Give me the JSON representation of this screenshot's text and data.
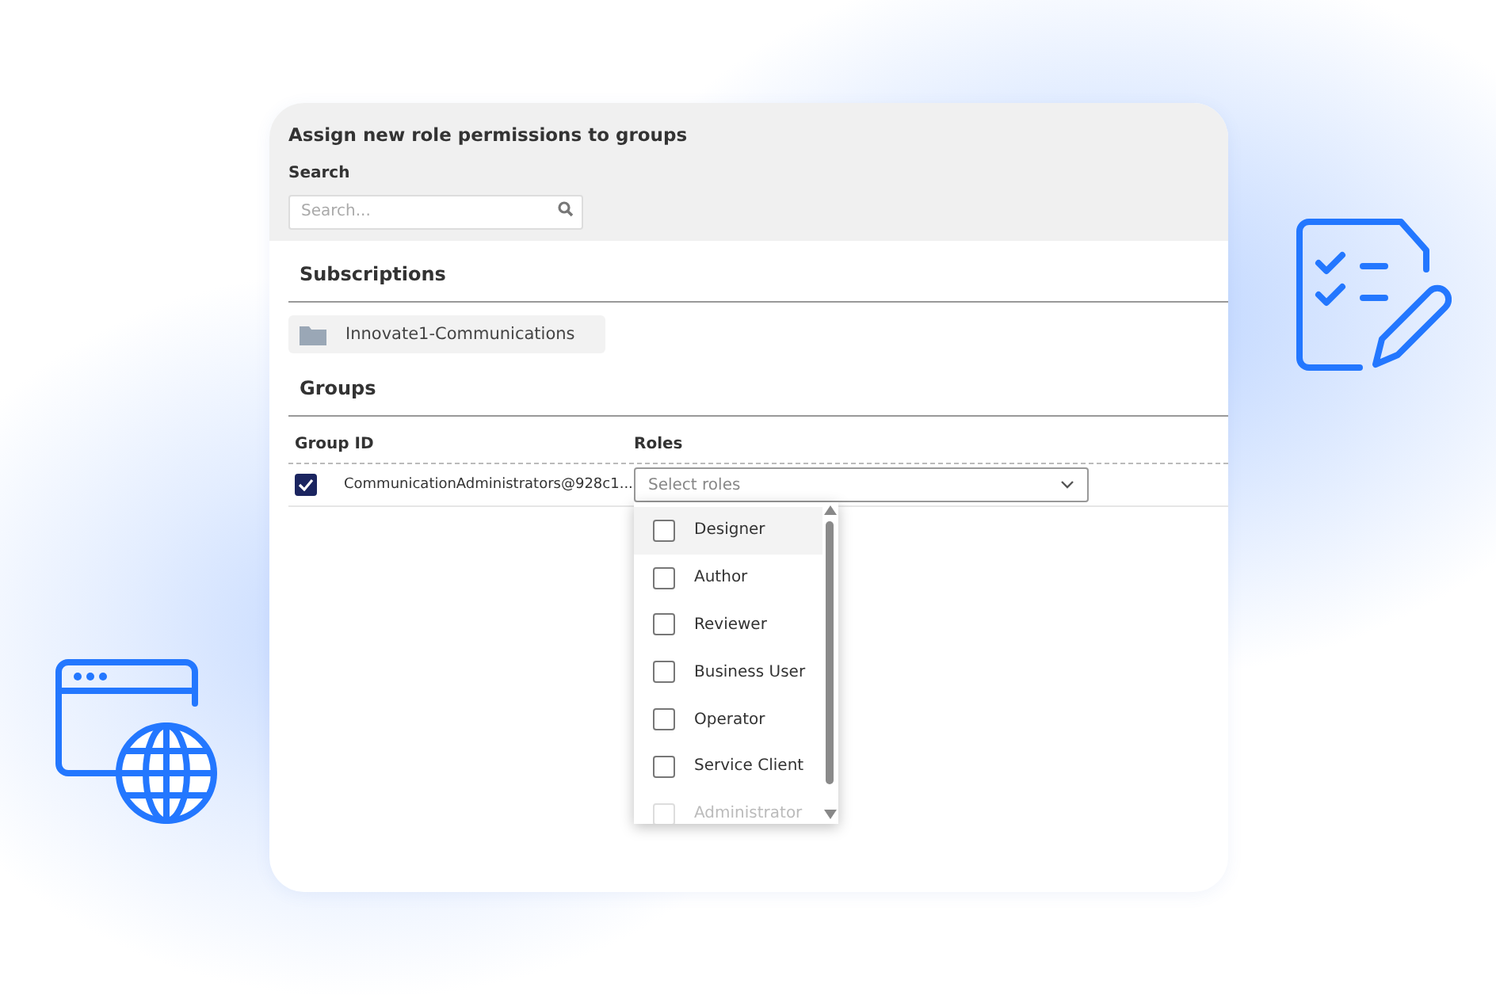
{
  "dialog": {
    "title": "Assign new role permissions to groups",
    "search_label": "Search",
    "search": {
      "placeholder": "Search..."
    }
  },
  "subscriptions": {
    "heading": "Subscriptions",
    "items": [
      {
        "label": "Innovate1-Communications"
      }
    ]
  },
  "groups": {
    "heading": "Groups",
    "columns": [
      "Group ID",
      "Roles"
    ],
    "rows": [
      {
        "checked": true,
        "group_id": "CommunicationAdministrators@928c1...",
        "roles": {
          "placeholder": "Select roles"
        }
      }
    ]
  },
  "roles_dropdown": {
    "options": [
      {
        "label": "Designer",
        "checked": false,
        "highlighted": true,
        "disabled": false
      },
      {
        "label": "Author",
        "checked": false,
        "highlighted": false,
        "disabled": false
      },
      {
        "label": "Reviewer",
        "checked": false,
        "highlighted": false,
        "disabled": false
      },
      {
        "label": "Business User",
        "checked": false,
        "highlighted": false,
        "disabled": false
      },
      {
        "label": "Operator",
        "checked": false,
        "highlighted": false,
        "disabled": false
      },
      {
        "label": "Service Client",
        "checked": false,
        "highlighted": false,
        "disabled": false
      },
      {
        "label": "Administrator",
        "checked": false,
        "highlighted": false,
        "disabled": true
      }
    ]
  }
}
